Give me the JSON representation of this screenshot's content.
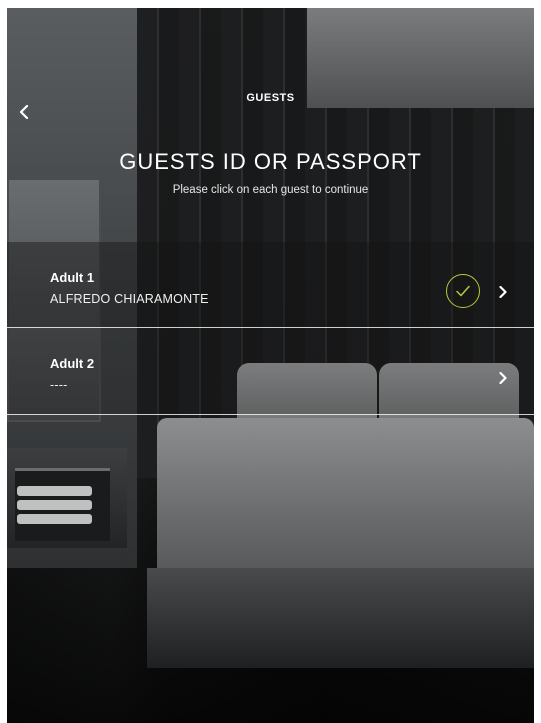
{
  "header": {
    "title": "GUESTS"
  },
  "main": {
    "title": "GUESTS ID OR PASSPORT",
    "subtitle": "Please click on each guest to continue"
  },
  "guests": [
    {
      "label": "Adult 1",
      "name": "ALFREDO CHIARAMONTE",
      "completed": true
    },
    {
      "label": "Adult 2",
      "name": "----",
      "completed": false
    }
  ],
  "colors": {
    "check_accent": "#b6c93a",
    "text": "#ffffff"
  },
  "icons": {
    "back": "chevron-left-icon",
    "row_arrow": "chevron-right-icon",
    "completed": "check-circle-icon"
  }
}
